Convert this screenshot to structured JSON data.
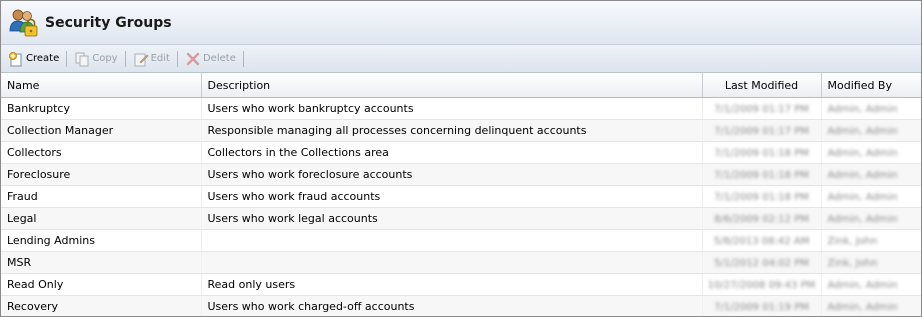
{
  "window": {
    "title": "Security Groups",
    "icon": "users-lock-icon"
  },
  "toolbar": {
    "buttons": [
      {
        "label": "Create",
        "icon": "create-icon",
        "enabled": true
      },
      {
        "label": "Copy",
        "icon": "copy-icon",
        "enabled": false
      },
      {
        "label": "Edit",
        "icon": "edit-icon",
        "enabled": false
      },
      {
        "label": "Delete",
        "icon": "delete-icon",
        "enabled": false
      }
    ]
  },
  "table": {
    "columns": [
      "Name",
      "Description",
      "Last Modified",
      "Modified By"
    ],
    "rows": [
      {
        "name": "Bankruptcy",
        "description": "Users who work bankruptcy accounts",
        "last_modified": "7/1/2009 01:17 PM",
        "modified_by": "Admin, Admin"
      },
      {
        "name": "Collection Manager",
        "description": "Responsible managing all processes concerning delinquent accounts",
        "last_modified": "7/1/2009 01:17 PM",
        "modified_by": "Admin, Admin"
      },
      {
        "name": "Collectors",
        "description": "Collectors in the Collections area",
        "last_modified": "7/1/2009 01:18 PM",
        "modified_by": "Admin, Admin"
      },
      {
        "name": "Foreclosure",
        "description": "Users who work foreclosure accounts",
        "last_modified": "7/1/2009 01:18 PM",
        "modified_by": "Admin, Admin"
      },
      {
        "name": "Fraud",
        "description": "Users who work fraud accounts",
        "last_modified": "7/1/2009 01:18 PM",
        "modified_by": "Admin, Admin"
      },
      {
        "name": "Legal",
        "description": "Users who work legal accounts",
        "last_modified": "8/6/2009 02:12 PM",
        "modified_by": "Admin, Admin"
      },
      {
        "name": "Lending Admins",
        "description": "",
        "last_modified": "5/8/2013 08:42 AM",
        "modified_by": "Zink, John"
      },
      {
        "name": "MSR",
        "description": "",
        "last_modified": "5/1/2012 04:02 PM",
        "modified_by": "Zink, John"
      },
      {
        "name": "Read Only",
        "description": "Read only users",
        "last_modified": "10/27/2008 09:43 PM",
        "modified_by": "Admin, Admin"
      },
      {
        "name": "Recovery",
        "description": "Users who work charged-off accounts",
        "last_modified": "7/1/2009 01:19 PM",
        "modified_by": "Admin, Admin"
      }
    ]
  },
  "colors": {
    "accent": "#1a1a1a",
    "disabled_text": "#9aa0a8",
    "delete_icon": "#c0392b"
  }
}
